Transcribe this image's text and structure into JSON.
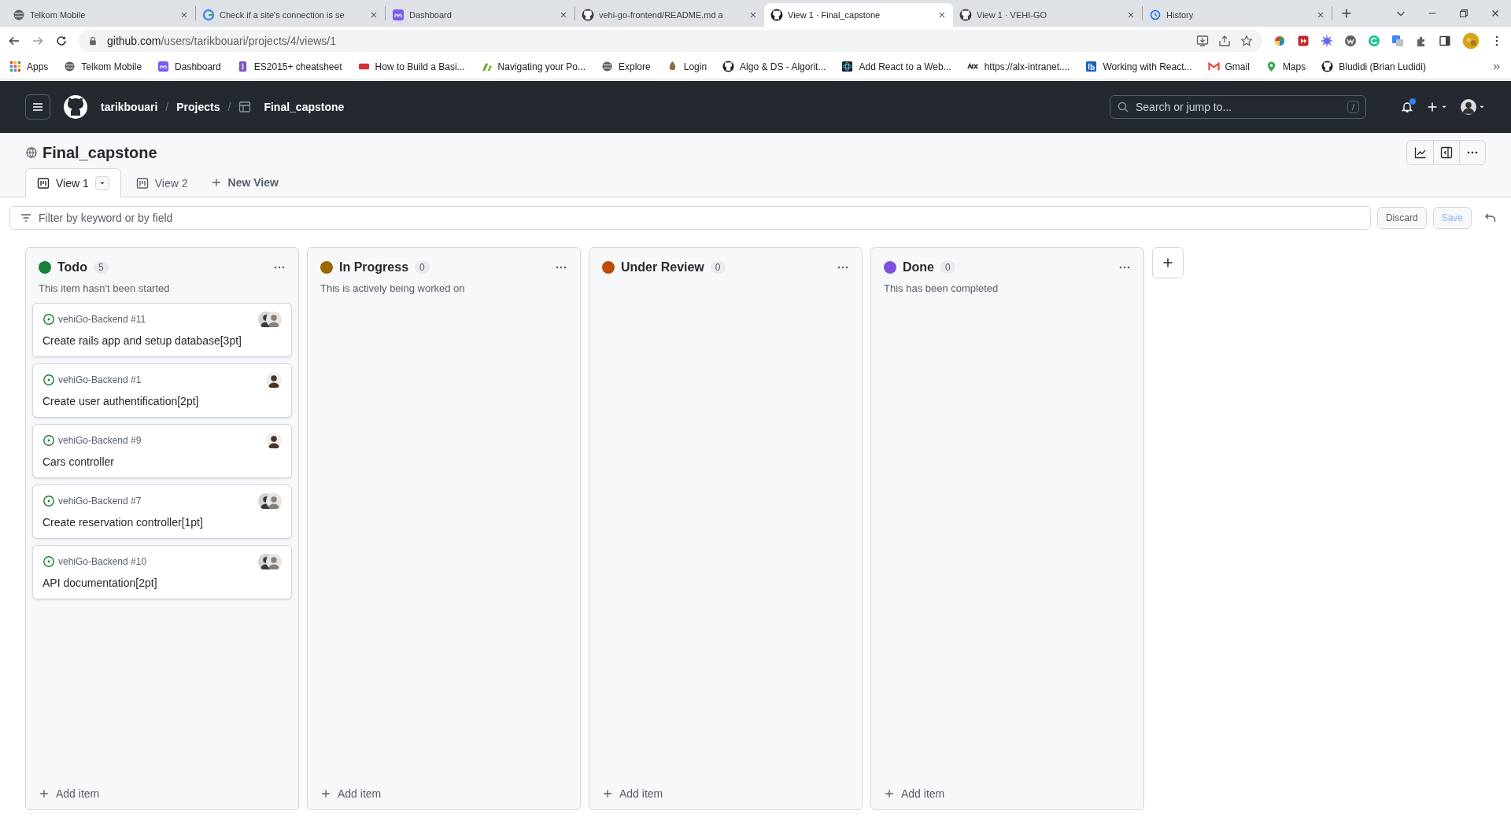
{
  "browser_tabs": [
    {
      "title": "Telkom Mobile",
      "selected": false
    },
    {
      "title": "Check if a site's connection is se",
      "selected": false
    },
    {
      "title": "Dashboard",
      "selected": false
    },
    {
      "title": "vehi-go-frontend/README.md a",
      "selected": false
    },
    {
      "title": "View 1 · Final_capstone",
      "selected": true
    },
    {
      "title": "View 1 · VEHI-GO",
      "selected": false
    },
    {
      "title": "History",
      "selected": false
    }
  ],
  "address_bar": {
    "host": "github.com",
    "path": "/users/tarikbouari/projects/4/views/1"
  },
  "bookmarks": [
    "Apps",
    "Telkom Mobile",
    "Dashboard",
    "ES2015+ cheatsheet",
    "How to Build a Basi...",
    "Navigating your Po...",
    "Explore",
    "Login",
    "Algo & DS - Algorit...",
    "Add React to a Web...",
    "https://alx-intranet....",
    "Working with React...",
    "Gmail",
    "Maps",
    "Bludidi (Brian Ludidi)"
  ],
  "header": {
    "breadcrumbs": [
      {
        "label": "tarikbouari",
        "separator": "/"
      },
      {
        "label": "Projects",
        "separator": "/"
      },
      {
        "label": "Final_capstone"
      }
    ],
    "search": {
      "placeholder": "Search or jump to...",
      "shortcut": "/"
    },
    "unread_notifications": true
  },
  "project": {
    "title": "Final_capstone"
  },
  "view_tabs": [
    {
      "label": "View 1",
      "selected": true
    },
    {
      "label": "View 2",
      "selected": false
    }
  ],
  "new_view": "New View",
  "filter_bar": {
    "placeholder": "Filter by keyword or by field",
    "discard": {
      "label": "Discard",
      "disabled": false
    },
    "save": {
      "label": "Save",
      "disabled": true
    }
  },
  "columns": [
    {
      "name": "Todo",
      "color": "#1a7f37",
      "count": "5",
      "description": "This item hasn't been started",
      "add_item": "Add item",
      "cards": [
        {
          "repo": "vehiGo-Backend #11",
          "title": "Create rails app and setup database[3pt]",
          "avatar_stack": true
        },
        {
          "repo": "vehiGo-Backend #1",
          "title": "Create user authentification[2pt]",
          "avatar_stack": false
        },
        {
          "repo": "vehiGo-Backend #9",
          "title": "Cars controller",
          "avatar_stack": false
        },
        {
          "repo": "vehiGo-Backend #7",
          "title": "Create reservation controller[1pt]",
          "avatar_stack": true
        },
        {
          "repo": "vehiGo-Backend #10",
          "title": "API documentation[2pt]",
          "avatar_stack": true
        }
      ]
    },
    {
      "name": "In Progress",
      "color": "#9a6700",
      "count": "0",
      "description": "This is actively being worked on",
      "add_item": "Add item"
    },
    {
      "name": "Under Review",
      "color": "#bc4c00",
      "count": "0",
      "add_item": "Add item"
    },
    {
      "name": "Done",
      "color": "#8250df",
      "count": "0",
      "description": "This has been completed",
      "add_item": "Add item"
    }
  ]
}
